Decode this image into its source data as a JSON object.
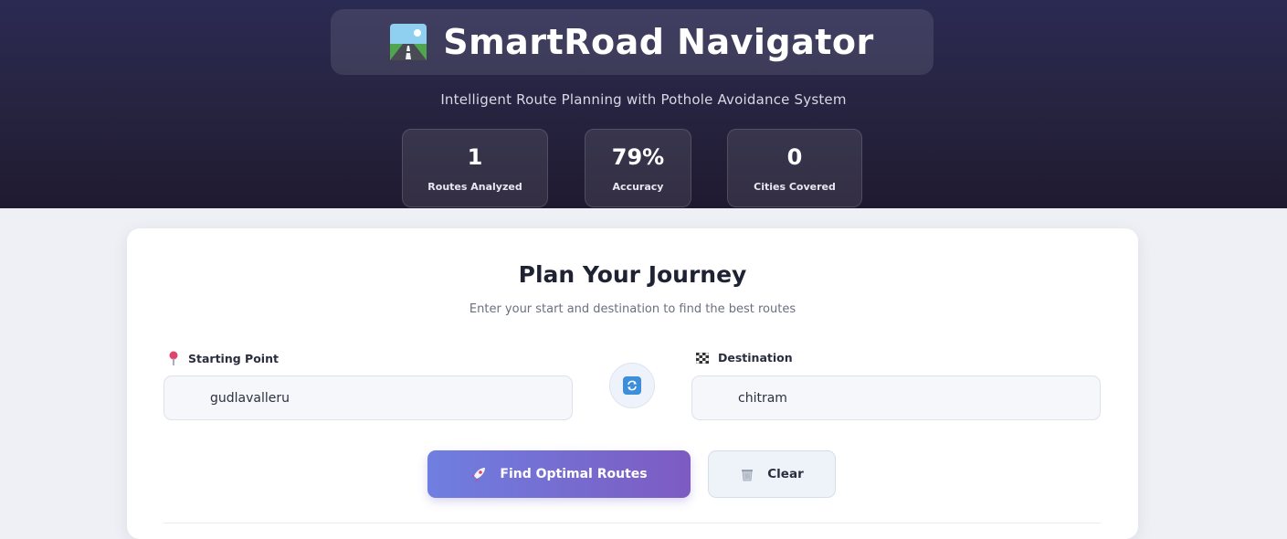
{
  "header": {
    "title": "SmartRoad Navigator",
    "subtitle": "Intelligent Route Planning with Pothole Avoidance System",
    "title_icon": "road-icon"
  },
  "stats": [
    {
      "value": "1",
      "label": "Routes Analyzed"
    },
    {
      "value": "79%",
      "label": "Accuracy"
    },
    {
      "value": "0",
      "label": "Cities Covered"
    }
  ],
  "planner": {
    "title": "Plan Your Journey",
    "subtitle": "Enter your start and destination to find the best routes",
    "start_label": "Starting Point",
    "start_value": "gudlavalleru",
    "start_icon": "pin-icon",
    "dest_label": "Destination",
    "dest_value": "chitram",
    "dest_icon": "checkered-flag-icon",
    "swap_icon": "swap-icon",
    "find_label": "Find Optimal Routes",
    "find_icon": "rocket-icon",
    "clear_label": "Clear",
    "clear_icon": "trash-icon"
  },
  "colors": {
    "hero_bg": "#26233f",
    "accent_start": "#6f7fe0",
    "accent_end": "#7d5bc2",
    "pin": "#e0446a",
    "swap": "#3d8fd9"
  }
}
